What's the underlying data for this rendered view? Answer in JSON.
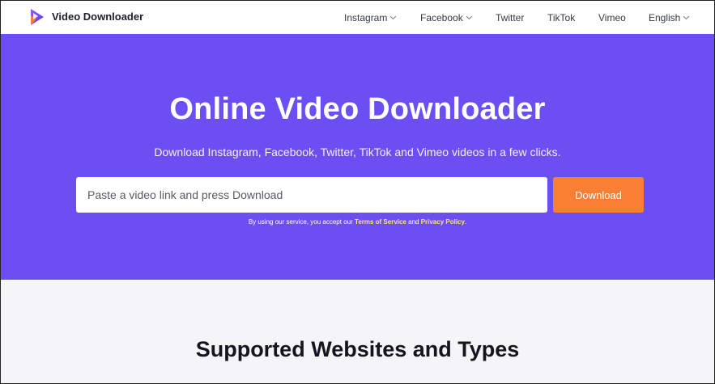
{
  "brand": {
    "name": "Video Downloader"
  },
  "nav": {
    "items": [
      {
        "label": "Instagram",
        "dropdown": true
      },
      {
        "label": "Facebook",
        "dropdown": true
      },
      {
        "label": "Twitter",
        "dropdown": false
      },
      {
        "label": "TikTok",
        "dropdown": false
      },
      {
        "label": "Vimeo",
        "dropdown": false
      },
      {
        "label": "English",
        "dropdown": true
      }
    ]
  },
  "hero": {
    "title": "Online Video Downloader",
    "subtitle": "Download Instagram, Facebook, Twitter, TikTok and Vimeo videos in a few clicks.",
    "input_placeholder": "Paste a video link and press Download",
    "input_value": "",
    "download_label": "Download",
    "terms_prefix": "By using our service, you accept our ",
    "terms_link": "Terms of Service",
    "terms_and": " and ",
    "privacy_link": "Privacy Policy",
    "terms_suffix": "."
  },
  "section": {
    "title": "Supported Websites and Types"
  },
  "colors": {
    "hero_bg": "#6c4ff2",
    "accent_orange": "#f97f35",
    "link_yellow": "#ffe66b",
    "page_bg": "#f5f5f8"
  },
  "icons": {
    "logo": "play-triangle-logo-icon",
    "dropdown": "chevron-down-icon"
  }
}
